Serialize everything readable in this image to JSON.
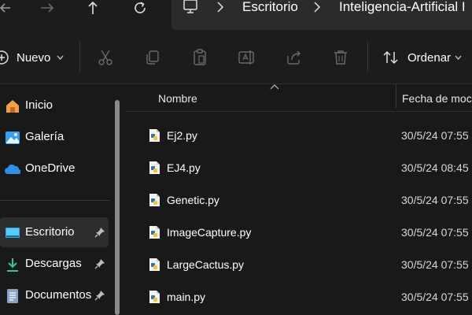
{
  "breadcrumb": {
    "items": [
      "Escritorio",
      "Inteligencia-Artificial I"
    ]
  },
  "toolbar": {
    "new_label": "Nuevo",
    "sort_label": "Ordenar",
    "icons": [
      "cut-icon",
      "copy-icon",
      "paste-icon",
      "rename-icon",
      "share-icon",
      "delete-icon"
    ]
  },
  "sidebar": {
    "items": [
      {
        "label": "Inicio",
        "icon": "home-icon"
      },
      {
        "label": "Galería",
        "icon": "gallery-icon"
      },
      {
        "label": "OneDrive",
        "icon": "onedrive-icon"
      },
      {
        "label": "Escritorio",
        "icon": "desktop-icon",
        "pinned": true,
        "selected": true
      },
      {
        "label": "Descargas",
        "icon": "download-icon",
        "pinned": true
      },
      {
        "label": "Documentos",
        "icon": "documents-icon",
        "pinned": true
      }
    ]
  },
  "columns": {
    "name": "Nombre",
    "date": "Fecha de moc"
  },
  "files": [
    {
      "name": "Ej2.py",
      "date": "30/5/24 07:55"
    },
    {
      "name": "EJ4.py",
      "date": "30/5/24 08:45"
    },
    {
      "name": "Genetic.py",
      "date": "30/5/24 07:55"
    },
    {
      "name": "ImageCapture.py",
      "date": "30/5/24 07:55"
    },
    {
      "name": "LargeCactus.py",
      "date": "30/5/24 07:55"
    },
    {
      "name": "main.py",
      "date": "30/5/24 07:55"
    }
  ],
  "colors": {
    "background": "#191919",
    "selected": "#2d2d2d",
    "accent": "#4cc2ff"
  }
}
